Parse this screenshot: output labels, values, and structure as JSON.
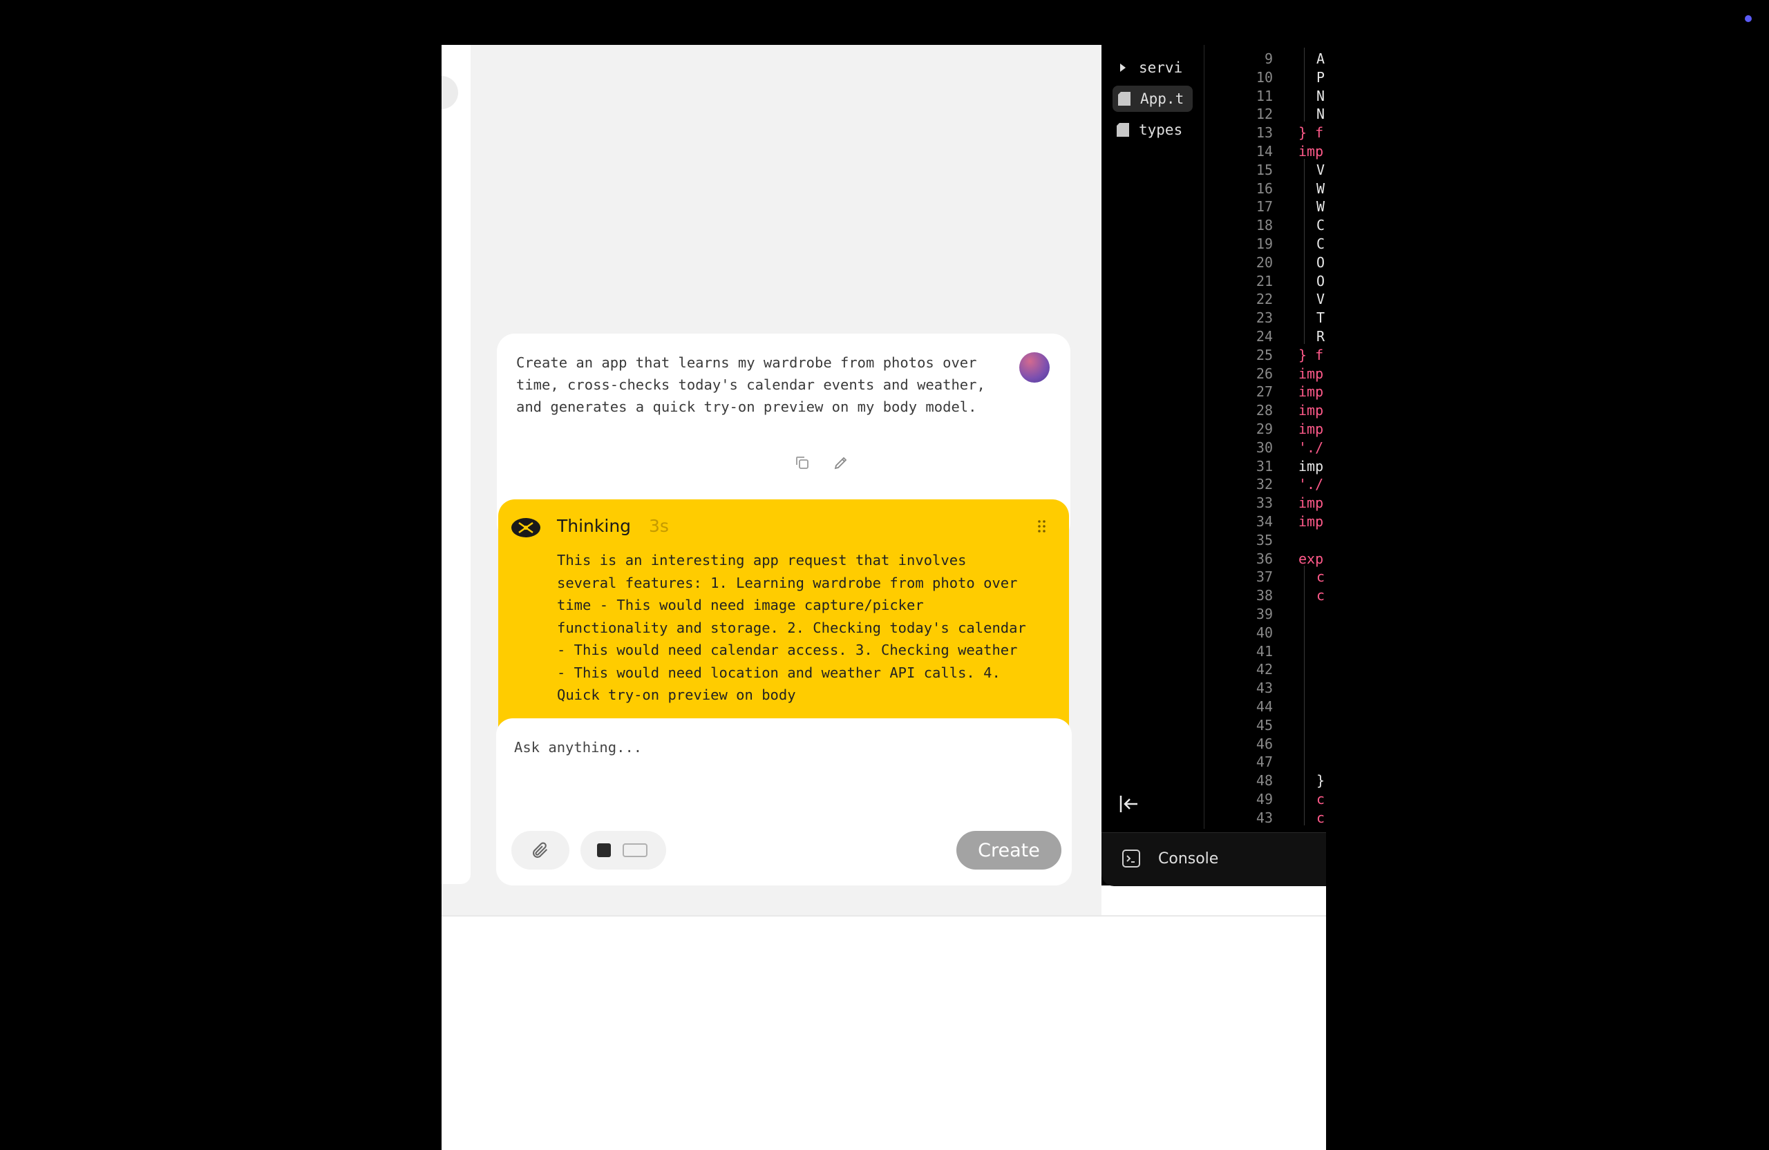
{
  "chat": {
    "user_message": "Create an app that learns my wardrobe from photos over time, cross-checks today's calendar events and weather, and generates a quick try-on preview on my body model.",
    "thinking": {
      "title": "Thinking",
      "duration": "3s",
      "text": "This is an interesting app request that involves several features: 1. Learning wardrobe from photo over time - This would need image capture/picker functionality and storage. 2. Checking today's calendar - This would need calendar access. 3. Checking weather - This would need location and weather API calls. 4. Quick try-on preview on body"
    },
    "composer": {
      "placeholder": "Ask anything...",
      "create_label": "Create"
    }
  },
  "editor": {
    "files": [
      {
        "name": "servi",
        "icon": "chevron-right-icon"
      },
      {
        "name": "App.t",
        "icon": "file-icon",
        "active": true
      },
      {
        "name": "types",
        "icon": "file-icon"
      }
    ],
    "line_numbers": [
      "9",
      "10",
      "11",
      "12",
      "13",
      "14",
      "15",
      "16",
      "17",
      "18",
      "19",
      "20",
      "21",
      "22",
      "23",
      "24",
      "25",
      "26",
      "27",
      "28",
      "29",
      "30",
      "31",
      "32",
      "33",
      "34",
      "35",
      "36",
      "37",
      "38",
      "39",
      "40",
      "41",
      "42",
      "43",
      "44",
      "45",
      "46",
      "47",
      "48",
      "49",
      "43"
    ],
    "code_lines": [
      {
        "text": "A",
        "color": "#e8e8e8",
        "indent": 1
      },
      {
        "text": "P",
        "color": "#e8e8e8",
        "indent": 1
      },
      {
        "text": "N",
        "color": "#e8e8e8",
        "indent": 1
      },
      {
        "text": "N",
        "color": "#e8e8e8",
        "indent": 1
      },
      {
        "text": "} f",
        "color": "#ff5a8a",
        "indent": 0
      },
      {
        "text": "imp",
        "color": "#ff5a8a",
        "indent": 0
      },
      {
        "text": "V",
        "color": "#e8e8e8",
        "indent": 1
      },
      {
        "text": "W",
        "color": "#e8e8e8",
        "indent": 1
      },
      {
        "text": "W",
        "color": "#e8e8e8",
        "indent": 1
      },
      {
        "text": "C",
        "color": "#e8e8e8",
        "indent": 1
      },
      {
        "text": "C",
        "color": "#e8e8e8",
        "indent": 1
      },
      {
        "text": "O",
        "color": "#e8e8e8",
        "indent": 1
      },
      {
        "text": "O",
        "color": "#e8e8e8",
        "indent": 1
      },
      {
        "text": "V",
        "color": "#e8e8e8",
        "indent": 1
      },
      {
        "text": "T",
        "color": "#e8e8e8",
        "indent": 1
      },
      {
        "text": "R",
        "color": "#e8e8e8",
        "indent": 1
      },
      {
        "text": "} f",
        "color": "#ff5a8a",
        "indent": 0
      },
      {
        "text": "imp",
        "color": "#ff5a8a",
        "indent": 0
      },
      {
        "text": "imp",
        "color": "#ff5a8a",
        "indent": 0
      },
      {
        "text": "imp",
        "color": "#ff5a8a",
        "indent": 0
      },
      {
        "text": "imp",
        "color": "#ff5a8a",
        "indent": 0
      },
      {
        "text": "'./",
        "color": "#ff5a8a",
        "indent": 0
      },
      {
        "text": "imp",
        "color": "#e8e8e8",
        "indent": 0
      },
      {
        "text": "'./",
        "color": "#ff5a8a",
        "indent": 0
      },
      {
        "text": "imp",
        "color": "#ff5a8a",
        "indent": 0
      },
      {
        "text": "imp",
        "color": "#ff5a8a",
        "indent": 0
      },
      {
        "text": "",
        "color": "#e8e8e8",
        "indent": 0
      },
      {
        "text": "exp",
        "color": "#ff5a8a",
        "indent": 0
      },
      {
        "text": "c",
        "color": "#ff5a8a",
        "indent": 1
      },
      {
        "text": "c",
        "color": "#ff5a8a",
        "indent": 1
      },
      {
        "text": "",
        "color": "#e8e8e8",
        "indent": 0
      },
      {
        "text": "",
        "color": "#e8e8e8",
        "indent": 0
      },
      {
        "text": "",
        "color": "#e8e8e8",
        "indent": 0
      },
      {
        "text": "",
        "color": "#e8e8e8",
        "indent": 0
      },
      {
        "text": "",
        "color": "#e8e8e8",
        "indent": 0
      },
      {
        "text": "",
        "color": "#e8e8e8",
        "indent": 0
      },
      {
        "text": "",
        "color": "#e8e8e8",
        "indent": 0
      },
      {
        "text": "",
        "color": "#e8e8e8",
        "indent": 0
      },
      {
        "text": "",
        "color": "#e8e8e8",
        "indent": 0
      },
      {
        "text": "}",
        "color": "#e8e8e8",
        "indent": 1
      },
      {
        "text": "c",
        "color": "#ff5a8a",
        "indent": 1
      },
      {
        "text": "c",
        "color": "#ff5a8a",
        "indent": 1
      }
    ],
    "console_label": "Console"
  },
  "colors": {
    "accent_yellow": "#ffcc00",
    "create_button": "#a3a3a3",
    "code_keyword": "#ff5a8a",
    "indicator_dot": "#5b5bf5"
  }
}
